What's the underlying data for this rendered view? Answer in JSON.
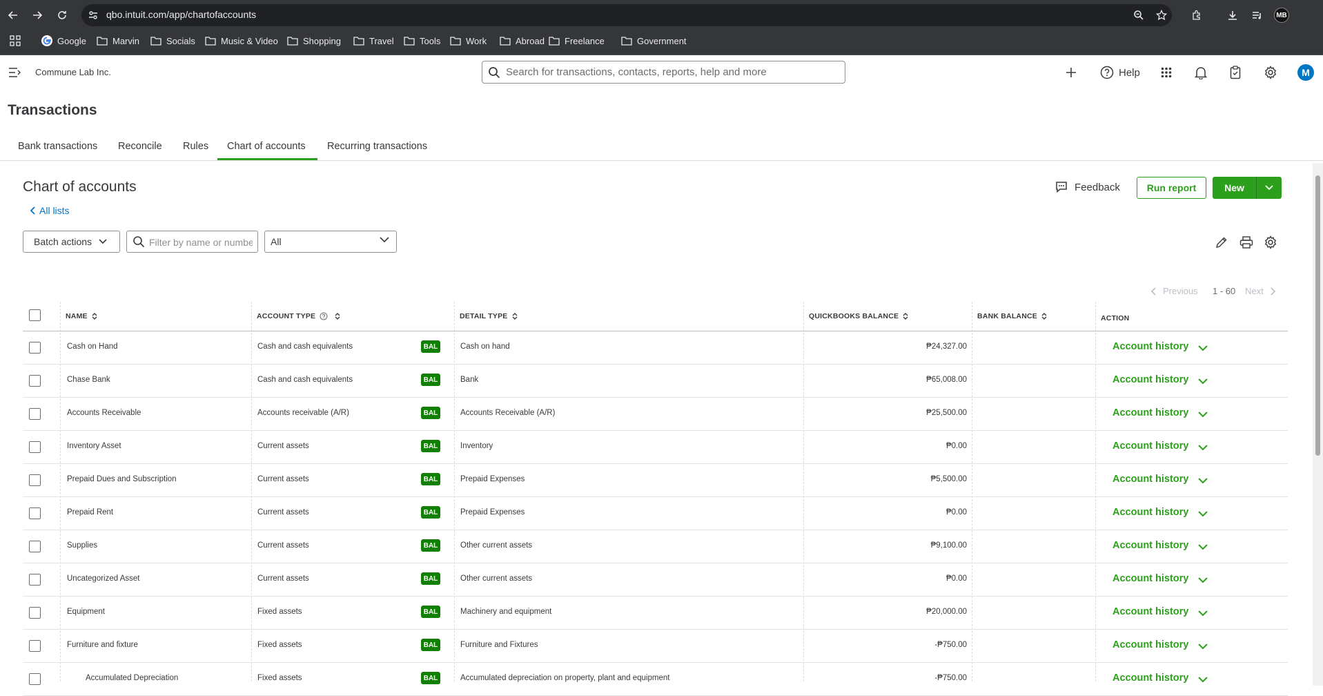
{
  "browser": {
    "url": "qbo.intuit.com/app/chartofaccounts",
    "profile_initials": "MB",
    "bookmarks": [
      "Google",
      "Marvin",
      "Socials",
      "Music & Video",
      "Shopping",
      "Travel",
      "Tools",
      "Work",
      "Abroad",
      "Freelance",
      "Government"
    ]
  },
  "header": {
    "company": "Commune Lab Inc.",
    "search_placeholder": "Search for transactions, contacts, reports, help and more",
    "help_label": "Help",
    "avatar_initial": "M"
  },
  "page": {
    "title": "Transactions",
    "tabs": [
      "Bank transactions",
      "Reconcile",
      "Rules",
      "Chart of accounts",
      "Recurring transactions"
    ],
    "active_tab": "Chart of accounts"
  },
  "coa": {
    "title": "Chart of accounts",
    "back_link": "All lists",
    "feedback_label": "Feedback",
    "run_report_label": "Run report",
    "new_label": "New",
    "batch_actions_label": "Batch actions",
    "filter_placeholder": "Filter by name or number",
    "type_filter_value": "All",
    "pager": {
      "previous": "Previous",
      "range": "1 - 60",
      "next": "Next"
    }
  },
  "table": {
    "columns": [
      "NAME",
      "ACCOUNT TYPE",
      "DETAIL TYPE",
      "QUICKBOOKS BALANCE",
      "BANK BALANCE",
      "ACTION"
    ],
    "badge_label": "BAL",
    "action_label": "Account history",
    "rows": [
      {
        "name": "Cash on Hand",
        "type": "Cash and cash equivalents",
        "detail": "Cash on hand",
        "balance": "₱24,327.00",
        "bank": ""
      },
      {
        "name": "Chase Bank",
        "type": "Cash and cash equivalents",
        "detail": "Bank",
        "balance": "₱65,008.00",
        "bank": ""
      },
      {
        "name": "Accounts Receivable",
        "type": "Accounts receivable (A/R)",
        "detail": "Accounts Receivable (A/R)",
        "balance": "₱25,500.00",
        "bank": ""
      },
      {
        "name": "Inventory Asset",
        "type": "Current assets",
        "detail": "Inventory",
        "balance": "₱0.00",
        "bank": ""
      },
      {
        "name": "Prepaid Dues and Subscription",
        "type": "Current assets",
        "detail": "Prepaid Expenses",
        "balance": "₱5,500.00",
        "bank": ""
      },
      {
        "name": "Prepaid Rent",
        "type": "Current assets",
        "detail": "Prepaid Expenses",
        "balance": "₱0.00",
        "bank": ""
      },
      {
        "name": "Supplies",
        "type": "Current assets",
        "detail": "Other current assets",
        "balance": "₱9,100.00",
        "bank": ""
      },
      {
        "name": "Uncategorized Asset",
        "type": "Current assets",
        "detail": "Other current assets",
        "balance": "₱0.00",
        "bank": ""
      },
      {
        "name": "Equipment",
        "type": "Fixed assets",
        "detail": "Machinery and equipment",
        "balance": "₱20,000.00",
        "bank": ""
      },
      {
        "name": "Furniture and fixture",
        "type": "Fixed assets",
        "detail": "Furniture and Fixtures",
        "balance": "-₱750.00",
        "bank": ""
      },
      {
        "name": "Accumulated Depreciation",
        "type": "Fixed assets",
        "detail": "Accumulated depreciation on property, plant and equipment",
        "balance": "-₱750.00",
        "bank": "",
        "sub": true
      }
    ]
  }
}
